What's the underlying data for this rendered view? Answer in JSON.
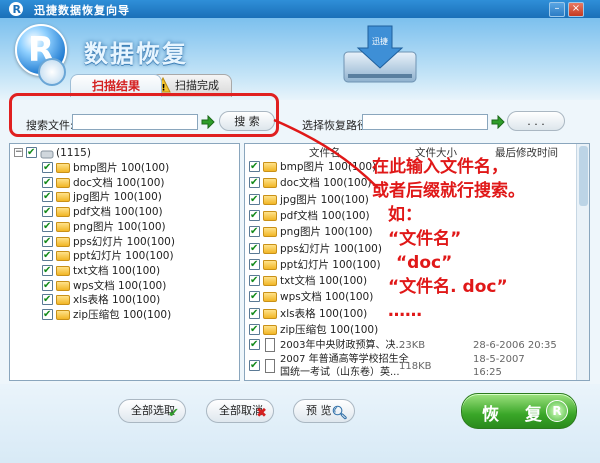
{
  "window": {
    "title": "迅捷数据恢复向导"
  },
  "header": {
    "app_title": "数据恢复",
    "drive_label": "迅捷"
  },
  "tabs": [
    {
      "label": "扫描结果"
    },
    {
      "label": "扫描完成"
    }
  ],
  "search": {
    "label": "搜索文件:",
    "value": "",
    "button": "搜 索"
  },
  "restore_path": {
    "label": "选择恢复路径",
    "value": "",
    "browse": ". . ."
  },
  "tree": {
    "root": {
      "label": "(1115)"
    },
    "items": [
      {
        "label": "bmp图片 100(100)"
      },
      {
        "label": "doc文档 100(100)"
      },
      {
        "label": "jpg图片 100(100)"
      },
      {
        "label": "pdf文档 100(100)"
      },
      {
        "label": "png图片 100(100)"
      },
      {
        "label": "pps幻灯片 100(100)"
      },
      {
        "label": "ppt幻灯片 100(100)"
      },
      {
        "label": "txt文档 100(100)"
      },
      {
        "label": "wps文档 100(100)"
      },
      {
        "label": "xls表格 100(100)"
      },
      {
        "label": "zip压缩包 100(100)"
      }
    ]
  },
  "file_list": {
    "columns": {
      "name": "文件名",
      "size": "文件大小",
      "modified": "最后修改时间"
    },
    "folders": [
      {
        "label": "bmp图片 100(100)"
      },
      {
        "label": "doc文档 100(100)"
      },
      {
        "label": "jpg图片 100(100)"
      },
      {
        "label": "pdf文档 100(100)"
      },
      {
        "label": "png图片 100(100)"
      },
      {
        "label": "pps幻灯片 100(100)"
      },
      {
        "label": "ppt幻灯片 100(100)"
      },
      {
        "label": "txt文档 100(100)"
      },
      {
        "label": "wps文档 100(100)"
      },
      {
        "label": "xls表格 100(100)"
      },
      {
        "label": "zip压缩包 100(100)"
      }
    ],
    "files": [
      {
        "name": "2003年中央财政预算、决...",
        "size": "23KB",
        "modified": "28-6-2006 20:35"
      },
      {
        "name_line1": "2007 年普通高等学校招生全",
        "name_line2": "国统一考试（山东卷）英...",
        "size": "118KB",
        "modified_line1": "18-5-2007",
        "modified_line2": "16:25"
      }
    ]
  },
  "buttons": {
    "select_all": "全部选取",
    "cancel_all": "全部取消",
    "preview": "预 览",
    "restore": "恢 复",
    "restore_badge": "R"
  },
  "annotation": {
    "lines": [
      "在此输入文件名，",
      "或者后缀就行搜索。",
      "如：",
      "“文件名”",
      "“doc”",
      "“文件名. doc”",
      "……"
    ]
  },
  "colors": {
    "annotation": "#e01818",
    "accent": "#1a6fb8",
    "restore_button": "#3aa628"
  }
}
